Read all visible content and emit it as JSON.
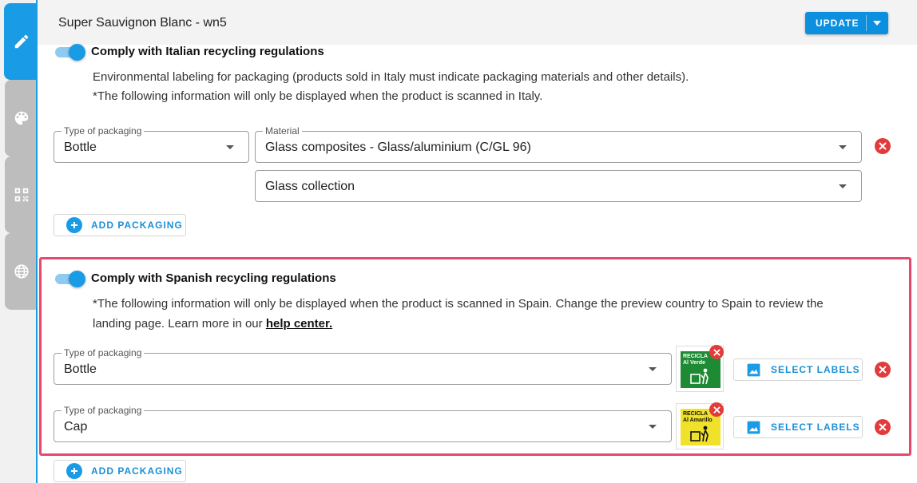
{
  "header": {
    "title": "Super Sauvignon Blanc - wn5",
    "update_label": "UPDATE"
  },
  "sidebar": {
    "tabs": [
      {
        "icon": "pencil-icon",
        "active": true
      },
      {
        "icon": "palette-icon",
        "active": false
      },
      {
        "icon": "qr-code-icon",
        "active": false
      },
      {
        "icon": "globe-icon",
        "active": false
      }
    ]
  },
  "italy": {
    "toggle_label": "Comply with Italian recycling regulations",
    "toggle_on": true,
    "desc_line1": "Environmental labeling for packaging (products sold in Italy must indicate packaging materials and other details).",
    "desc_line2": "*The following information will only be displayed when the product is scanned in Italy.",
    "packaging": {
      "type_label": "Type of packaging",
      "type_value": "Bottle",
      "material_label": "Material",
      "material_value": "Glass composites - Glass/aluminium (C/GL 96)",
      "collection_value": "Glass collection"
    },
    "add_label": "ADD PACKAGING"
  },
  "spain": {
    "toggle_label": "Comply with Spanish recycling regulations",
    "toggle_on": true,
    "desc_line1": "*The following information will only be displayed when the product is scanned in Spain. Change the preview country to Spain to review the",
    "desc_line2_prefix": "landing page. Learn more in our ",
    "help_link": "help center.",
    "rows": [
      {
        "type_label": "Type of packaging",
        "type_value": "Bottle",
        "label_title": "RECICLA\nAl Verde",
        "label_color": "#1e8a34",
        "select_label": "SELECT LABELS"
      },
      {
        "type_label": "Type of packaging",
        "type_value": "Cap",
        "label_title": "RECICLA\nAl Amarillo",
        "label_color": "#f0e12a",
        "select_label": "SELECT LABELS"
      }
    ],
    "add_label": "ADD PACKAGING"
  },
  "colors": {
    "accent": "#1a9be6",
    "highlight": "#e8486b",
    "danger": "#e23b3b"
  }
}
